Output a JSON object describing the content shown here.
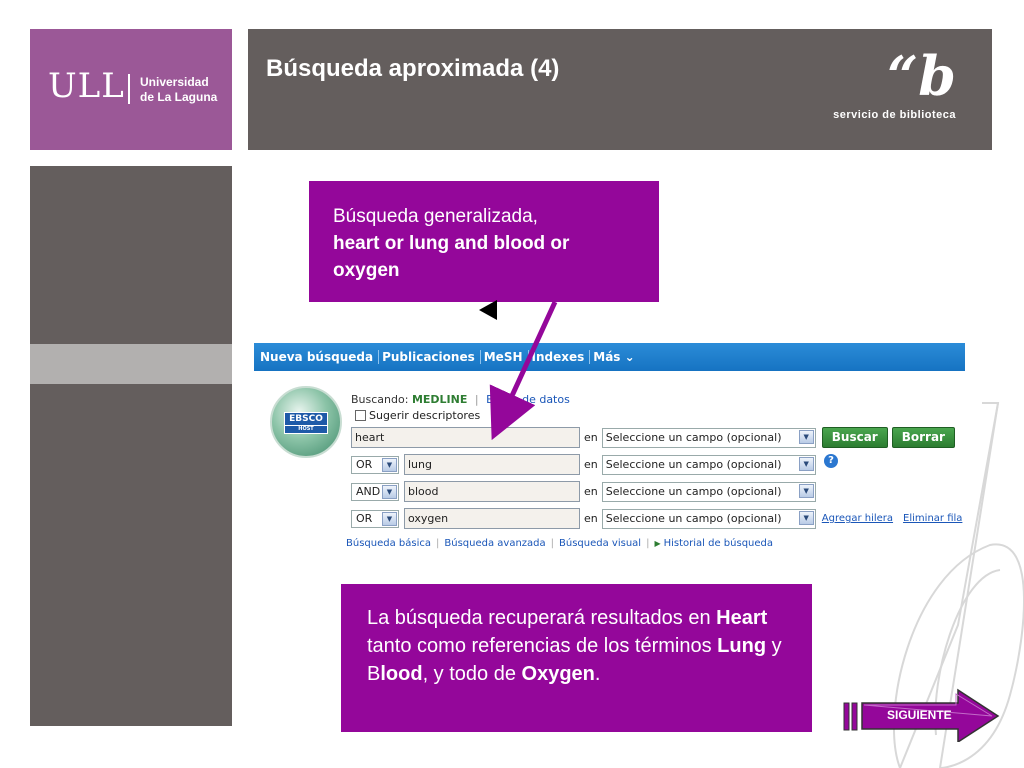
{
  "header": {
    "logo_mark": "ULL",
    "logo_name_line1": "Universidad",
    "logo_name_line2": "de La Laguna",
    "title": "Búsqueda aproximada (4)",
    "library_mark": "“b",
    "library_text": "servicio de biblioteca"
  },
  "callout_top": {
    "line1": "Búsqueda generalizada,",
    "line2_bold": "heart or lung and blood or oxygen"
  },
  "callout_bottom": {
    "t1": "La búsqueda recuperará resultados en ",
    "b1": "Heart",
    "t2": " tanto como referencias de los términos ",
    "b2": "Lung",
    "t3": " y B",
    "b3": "lood",
    "t4": ", y todo de ",
    "b4": "Oxygen",
    "t5": "."
  },
  "ebsco": {
    "nav": [
      "Nueva búsqueda",
      "Publicaciones",
      "MeSH",
      "Indexes",
      "Más ⌄"
    ],
    "logo_text": "EBSCO",
    "logo_sub": "HOST",
    "searching_label": "Buscando:",
    "database": "MEDLINE",
    "databases_link": "Bases de datos",
    "suggest_label": "Sugerir descriptores",
    "en_label": "en",
    "field_placeholder": "Seleccione un campo (opcional)",
    "rows": [
      {
        "op": "",
        "term": "heart"
      },
      {
        "op": "OR",
        "term": "lung"
      },
      {
        "op": "AND",
        "term": "blood"
      },
      {
        "op": "OR",
        "term": "oxygen"
      }
    ],
    "search_button": "Buscar",
    "clear_button": "Borrar",
    "help_icon": "?",
    "add_row": "Agregar hilera",
    "remove_row": "Eliminar fila",
    "bottom_links": [
      "Búsqueda básica",
      "Búsqueda avanzada",
      "Búsqueda visual",
      "Historial de búsqueda"
    ]
  },
  "next_button": "SIGUIENTE",
  "colors": {
    "purple": "#94079a",
    "logo_purple": "#9b5897",
    "gray": "#645e5d",
    "nav_blue": "#1673c2"
  }
}
